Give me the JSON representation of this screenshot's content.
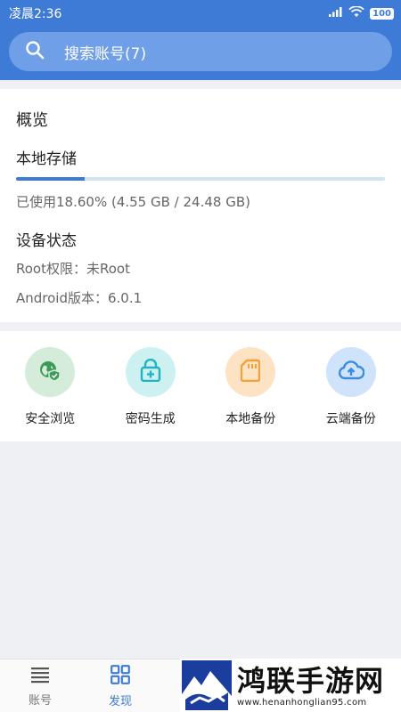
{
  "status_bar": {
    "time": "凌晨2:36",
    "battery": "100"
  },
  "search": {
    "placeholder": "搜索账号(7)"
  },
  "overview": {
    "title": "概览",
    "storage_label": "本地存储",
    "storage_used_fraction": 0.186,
    "storage_text": "已使用18.60% (4.55 GB / 24.48 GB)",
    "device_title": "设备状态",
    "root_text": "Root权限：未Root",
    "android_text": "Android版本：6.0.1"
  },
  "tools": [
    {
      "label": "安全浏览",
      "icon": "shield-globe-icon",
      "bg": "#d4ecd9",
      "fg": "#3d9b59"
    },
    {
      "label": "密码生成",
      "icon": "lock-plus-icon",
      "bg": "#cdf0f1",
      "fg": "#22b4c2"
    },
    {
      "label": "本地备份",
      "icon": "sd-card-icon",
      "bg": "#fde3c4",
      "fg": "#f2a23b"
    },
    {
      "label": "云端备份",
      "icon": "cloud-upload-icon",
      "bg": "#cfe4fa",
      "fg": "#3e8ae0"
    }
  ],
  "bottom_nav": {
    "accounts_label": "账号",
    "discover_label": "发现",
    "active": "发现"
  },
  "watermark": {
    "title": "鸿联手游网",
    "url": "www.henanhonglian95.com"
  },
  "colors": {
    "primary": "#3e7bd6",
    "search_bg": "#6f9fe6",
    "background": "#eef0f3"
  }
}
